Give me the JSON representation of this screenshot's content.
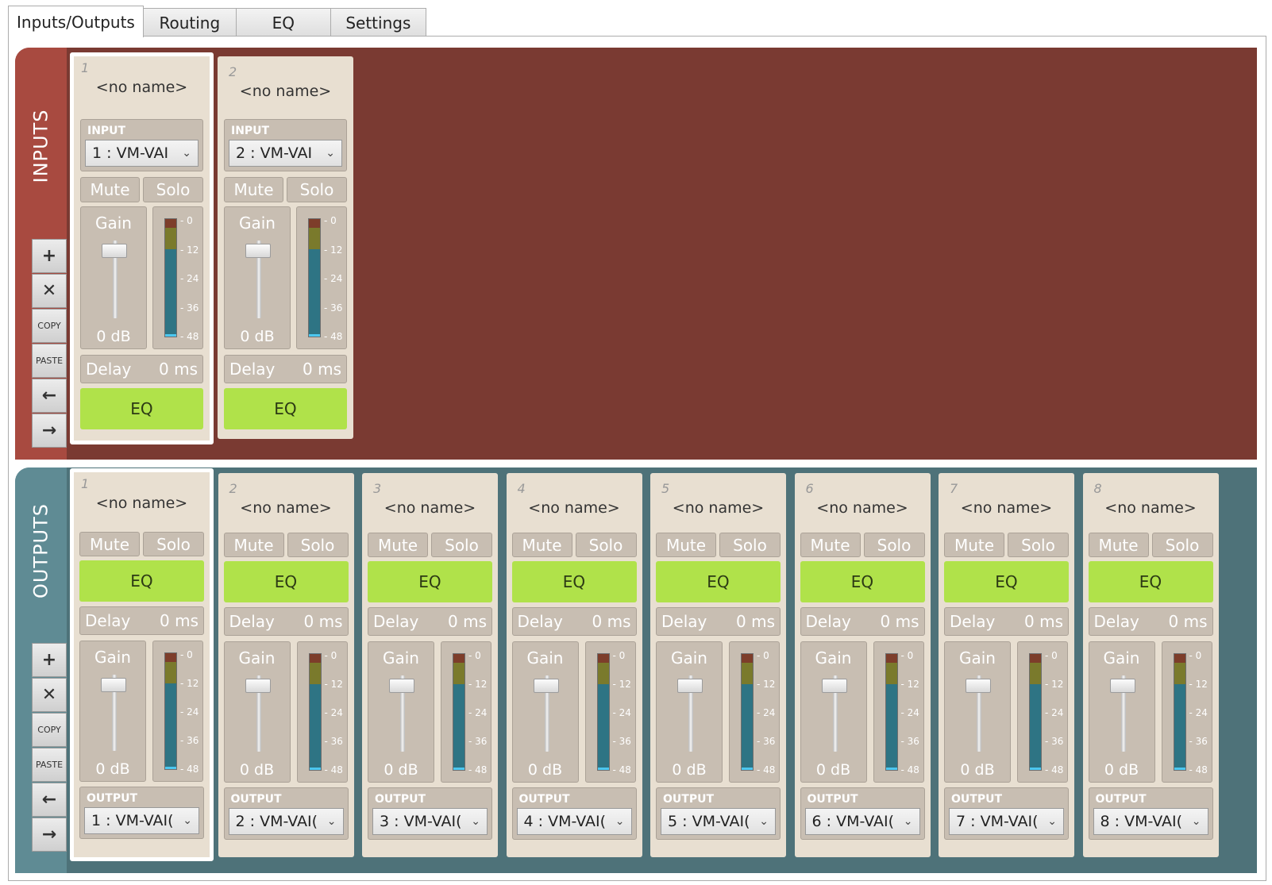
{
  "tabs": [
    "Inputs/Outputs",
    "Routing",
    "EQ",
    "Settings"
  ],
  "active_tab": 0,
  "inputs_label": "INPUTS",
  "outputs_label": "OUTPUTS",
  "side_buttons": {
    "add": "+",
    "remove": "✕",
    "copy": "COPY",
    "paste": "PASTE",
    "left": "←",
    "right": "→"
  },
  "strip_labels": {
    "no_name": "<no name>",
    "input": "INPUT",
    "output": "OUTPUT",
    "mute": "Mute",
    "solo": "Solo",
    "gain": "Gain",
    "gain_value": "0 dB",
    "delay": "Delay",
    "delay_value": "0 ms",
    "eq": "EQ",
    "meter_ticks": [
      "0",
      "12",
      "24",
      "36",
      "48"
    ]
  },
  "inputs": [
    {
      "num": "1",
      "source": "1 : VM-VAI",
      "selected": true
    },
    {
      "num": "2",
      "source": "2 : VM-VAI",
      "selected": false
    }
  ],
  "outputs": [
    {
      "num": "1",
      "dest": "1 : VM-VAI(",
      "selected": true
    },
    {
      "num": "2",
      "dest": "2 : VM-VAI(",
      "selected": false
    },
    {
      "num": "3",
      "dest": "3 : VM-VAI(",
      "selected": false
    },
    {
      "num": "4",
      "dest": "4 : VM-VAI(",
      "selected": false
    },
    {
      "num": "5",
      "dest": "5 : VM-VAI(",
      "selected": false
    },
    {
      "num": "6",
      "dest": "6 : VM-VAI(",
      "selected": false
    },
    {
      "num": "7",
      "dest": "7 : VM-VAI(",
      "selected": false
    },
    {
      "num": "8",
      "dest": "8 : VM-VAI(",
      "selected": false
    }
  ],
  "colors": {
    "inputs_panel": "#7a3a32",
    "outputs_panel": "#4e7279",
    "eq_button": "#b0e24a",
    "strip_bg": "#e8dfd1"
  }
}
